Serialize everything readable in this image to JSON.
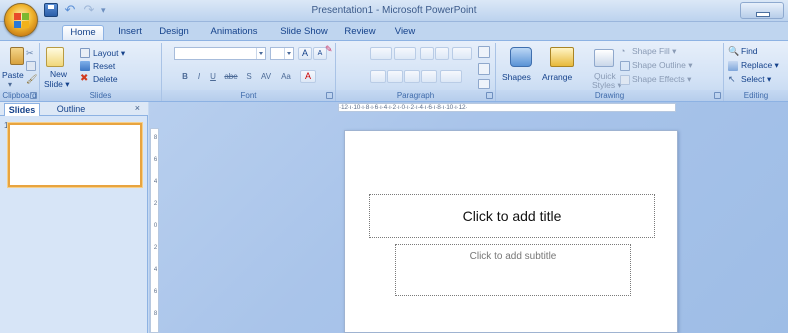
{
  "window": {
    "title": "Presentation1 - Microsoft PowerPoint"
  },
  "tabs": [
    "Home",
    "Insert",
    "Design",
    "Animations",
    "Slide Show",
    "Review",
    "View"
  ],
  "ribbon": {
    "clipboard": {
      "label": "Clipboard",
      "paste": "Paste"
    },
    "slides": {
      "label": "Slides",
      "new_slide": "New",
      "new_slide2": "Slide ▾",
      "layout": "Layout ▾",
      "reset": "Reset",
      "delete": "Delete"
    },
    "font": {
      "label": "Font",
      "bold": "B",
      "italic": "I",
      "underline": "U",
      "strike": "abe",
      "shadow": "S",
      "spacing": "AV",
      "case": "Aa",
      "color": "A",
      "grow": "A",
      "shrink": "A"
    },
    "paragraph": {
      "label": "Paragraph"
    },
    "drawing": {
      "label": "Drawing",
      "shapes": "Shapes",
      "arrange": "Arrange",
      "quick_styles": "Quick",
      "quick_styles2": "Styles ▾",
      "shape_fill": "Shape Fill ▾",
      "shape_outline": "Shape Outline ▾",
      "shape_effects": "Shape Effects ▾"
    },
    "editing": {
      "label": "Editing",
      "find": "Find",
      "replace": "Replace ▾",
      "select": "Select ▾"
    }
  },
  "panel": {
    "tabs": [
      "Slides",
      "Outline"
    ],
    "close": "×",
    "thumb_number": "1"
  },
  "ruler": {
    "horizontal": "·12·ı·10·ı·8·ı·6·ı·4·ı·2·ı·0·ı·2·ı·4·ı·6·ı·8·ı·10·ı·12·",
    "vertical": [
      "8",
      "6",
      "4",
      "2",
      "0",
      "2",
      "4",
      "6",
      "8"
    ]
  },
  "slide": {
    "title_placeholder": "Click to add title",
    "subtitle_placeholder": "Click to add subtitle"
  }
}
